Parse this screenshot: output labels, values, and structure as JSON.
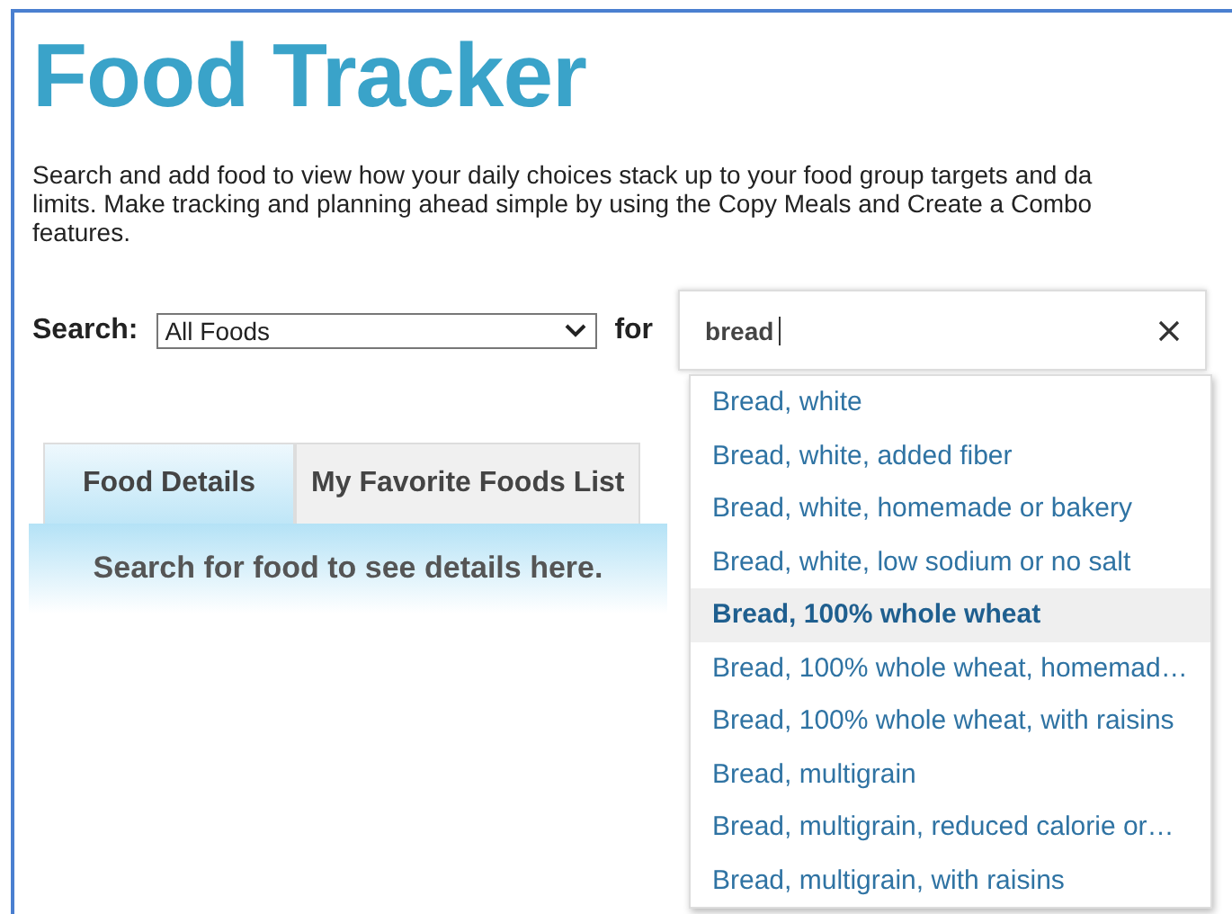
{
  "title": "Food Tracker",
  "intro_lines": [
    "Search and add food to view how your daily choices stack up to your food group targets and da",
    "limits. Make tracking and planning ahead simple by using the Copy Meals and Create a Combo",
    "features."
  ],
  "search": {
    "label": "Search:",
    "category": "All Foods",
    "for_label": "for",
    "value": "bread"
  },
  "tabs": [
    {
      "label": "Food Details",
      "selected": true
    },
    {
      "label": "My Favorite Foods List",
      "selected": false
    }
  ],
  "panel_message": "Search for food to see details here.",
  "suggestions": [
    {
      "label": "Bread, white",
      "selected": false
    },
    {
      "label": "Bread, white, added fiber",
      "selected": false
    },
    {
      "label": "Bread, white, homemade or bakery",
      "selected": false
    },
    {
      "label": "Bread, white, low sodium or no salt",
      "selected": false
    },
    {
      "label": "Bread, 100% whole wheat",
      "selected": true
    },
    {
      "label": "Bread, 100% whole wheat, homemad…",
      "selected": false
    },
    {
      "label": "Bread, 100% whole wheat, with raisins",
      "selected": false
    },
    {
      "label": "Bread, multigrain",
      "selected": false
    },
    {
      "label": "Bread, multigrain, reduced calorie or…",
      "selected": false
    },
    {
      "label": "Bread, multigrain, with raisins",
      "selected": false
    }
  ]
}
